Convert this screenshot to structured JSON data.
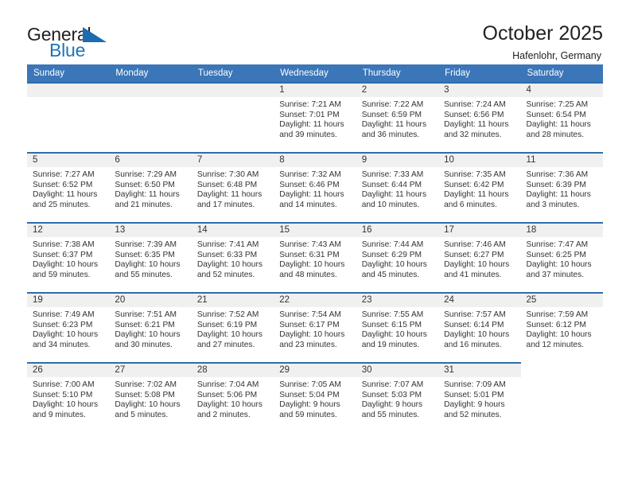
{
  "brand": {
    "name_top": "General",
    "name_bottom": "Blue",
    "triangle_color": "#1b6cb0",
    "blue_text_color": "#1b74bb"
  },
  "header": {
    "title": "October 2025",
    "subtitle": "Hafenlohr, Germany",
    "header_bg": "#3a76b8",
    "header_text_color": "#ffffff",
    "row_rule_color": "#2f6cad",
    "daynum_band_color": "#f0f0f0"
  },
  "weekdays": [
    "Sunday",
    "Monday",
    "Tuesday",
    "Wednesday",
    "Thursday",
    "Friday",
    "Saturday"
  ],
  "labels": {
    "sunrise": "Sunrise:",
    "sunset": "Sunset:",
    "daylight": "Daylight:"
  },
  "weeks": [
    [
      {
        "day": "",
        "empty": true
      },
      {
        "day": "",
        "empty": true
      },
      {
        "day": "",
        "empty": true
      },
      {
        "day": "1",
        "sunrise": "Sunrise: 7:21 AM",
        "sunset": "Sunset: 7:01 PM",
        "daylight": "Daylight: 11 hours and 39 minutes."
      },
      {
        "day": "2",
        "sunrise": "Sunrise: 7:22 AM",
        "sunset": "Sunset: 6:59 PM",
        "daylight": "Daylight: 11 hours and 36 minutes."
      },
      {
        "day": "3",
        "sunrise": "Sunrise: 7:24 AM",
        "sunset": "Sunset: 6:56 PM",
        "daylight": "Daylight: 11 hours and 32 minutes."
      },
      {
        "day": "4",
        "sunrise": "Sunrise: 7:25 AM",
        "sunset": "Sunset: 6:54 PM",
        "daylight": "Daylight: 11 hours and 28 minutes."
      }
    ],
    [
      {
        "day": "5",
        "sunrise": "Sunrise: 7:27 AM",
        "sunset": "Sunset: 6:52 PM",
        "daylight": "Daylight: 11 hours and 25 minutes."
      },
      {
        "day": "6",
        "sunrise": "Sunrise: 7:29 AM",
        "sunset": "Sunset: 6:50 PM",
        "daylight": "Daylight: 11 hours and 21 minutes."
      },
      {
        "day": "7",
        "sunrise": "Sunrise: 7:30 AM",
        "sunset": "Sunset: 6:48 PM",
        "daylight": "Daylight: 11 hours and 17 minutes."
      },
      {
        "day": "8",
        "sunrise": "Sunrise: 7:32 AM",
        "sunset": "Sunset: 6:46 PM",
        "daylight": "Daylight: 11 hours and 14 minutes."
      },
      {
        "day": "9",
        "sunrise": "Sunrise: 7:33 AM",
        "sunset": "Sunset: 6:44 PM",
        "daylight": "Daylight: 11 hours and 10 minutes."
      },
      {
        "day": "10",
        "sunrise": "Sunrise: 7:35 AM",
        "sunset": "Sunset: 6:42 PM",
        "daylight": "Daylight: 11 hours and 6 minutes."
      },
      {
        "day": "11",
        "sunrise": "Sunrise: 7:36 AM",
        "sunset": "Sunset: 6:39 PM",
        "daylight": "Daylight: 11 hours and 3 minutes."
      }
    ],
    [
      {
        "day": "12",
        "sunrise": "Sunrise: 7:38 AM",
        "sunset": "Sunset: 6:37 PM",
        "daylight": "Daylight: 10 hours and 59 minutes."
      },
      {
        "day": "13",
        "sunrise": "Sunrise: 7:39 AM",
        "sunset": "Sunset: 6:35 PM",
        "daylight": "Daylight: 10 hours and 55 minutes."
      },
      {
        "day": "14",
        "sunrise": "Sunrise: 7:41 AM",
        "sunset": "Sunset: 6:33 PM",
        "daylight": "Daylight: 10 hours and 52 minutes."
      },
      {
        "day": "15",
        "sunrise": "Sunrise: 7:43 AM",
        "sunset": "Sunset: 6:31 PM",
        "daylight": "Daylight: 10 hours and 48 minutes."
      },
      {
        "day": "16",
        "sunrise": "Sunrise: 7:44 AM",
        "sunset": "Sunset: 6:29 PM",
        "daylight": "Daylight: 10 hours and 45 minutes."
      },
      {
        "day": "17",
        "sunrise": "Sunrise: 7:46 AM",
        "sunset": "Sunset: 6:27 PM",
        "daylight": "Daylight: 10 hours and 41 minutes."
      },
      {
        "day": "18",
        "sunrise": "Sunrise: 7:47 AM",
        "sunset": "Sunset: 6:25 PM",
        "daylight": "Daylight: 10 hours and 37 minutes."
      }
    ],
    [
      {
        "day": "19",
        "sunrise": "Sunrise: 7:49 AM",
        "sunset": "Sunset: 6:23 PM",
        "daylight": "Daylight: 10 hours and 34 minutes."
      },
      {
        "day": "20",
        "sunrise": "Sunrise: 7:51 AM",
        "sunset": "Sunset: 6:21 PM",
        "daylight": "Daylight: 10 hours and 30 minutes."
      },
      {
        "day": "21",
        "sunrise": "Sunrise: 7:52 AM",
        "sunset": "Sunset: 6:19 PM",
        "daylight": "Daylight: 10 hours and 27 minutes."
      },
      {
        "day": "22",
        "sunrise": "Sunrise: 7:54 AM",
        "sunset": "Sunset: 6:17 PM",
        "daylight": "Daylight: 10 hours and 23 minutes."
      },
      {
        "day": "23",
        "sunrise": "Sunrise: 7:55 AM",
        "sunset": "Sunset: 6:15 PM",
        "daylight": "Daylight: 10 hours and 19 minutes."
      },
      {
        "day": "24",
        "sunrise": "Sunrise: 7:57 AM",
        "sunset": "Sunset: 6:14 PM",
        "daylight": "Daylight: 10 hours and 16 minutes."
      },
      {
        "day": "25",
        "sunrise": "Sunrise: 7:59 AM",
        "sunset": "Sunset: 6:12 PM",
        "daylight": "Daylight: 10 hours and 12 minutes."
      }
    ],
    [
      {
        "day": "26",
        "sunrise": "Sunrise: 7:00 AM",
        "sunset": "Sunset: 5:10 PM",
        "daylight": "Daylight: 10 hours and 9 minutes."
      },
      {
        "day": "27",
        "sunrise": "Sunrise: 7:02 AM",
        "sunset": "Sunset: 5:08 PM",
        "daylight": "Daylight: 10 hours and 5 minutes."
      },
      {
        "day": "28",
        "sunrise": "Sunrise: 7:04 AM",
        "sunset": "Sunset: 5:06 PM",
        "daylight": "Daylight: 10 hours and 2 minutes."
      },
      {
        "day": "29",
        "sunrise": "Sunrise: 7:05 AM",
        "sunset": "Sunset: 5:04 PM",
        "daylight": "Daylight: 9 hours and 59 minutes."
      },
      {
        "day": "30",
        "sunrise": "Sunrise: 7:07 AM",
        "sunset": "Sunset: 5:03 PM",
        "daylight": "Daylight: 9 hours and 55 minutes."
      },
      {
        "day": "31",
        "sunrise": "Sunrise: 7:09 AM",
        "sunset": "Sunset: 5:01 PM",
        "daylight": "Daylight: 9 hours and 52 minutes."
      },
      {
        "day": "",
        "empty": true
      }
    ]
  ]
}
